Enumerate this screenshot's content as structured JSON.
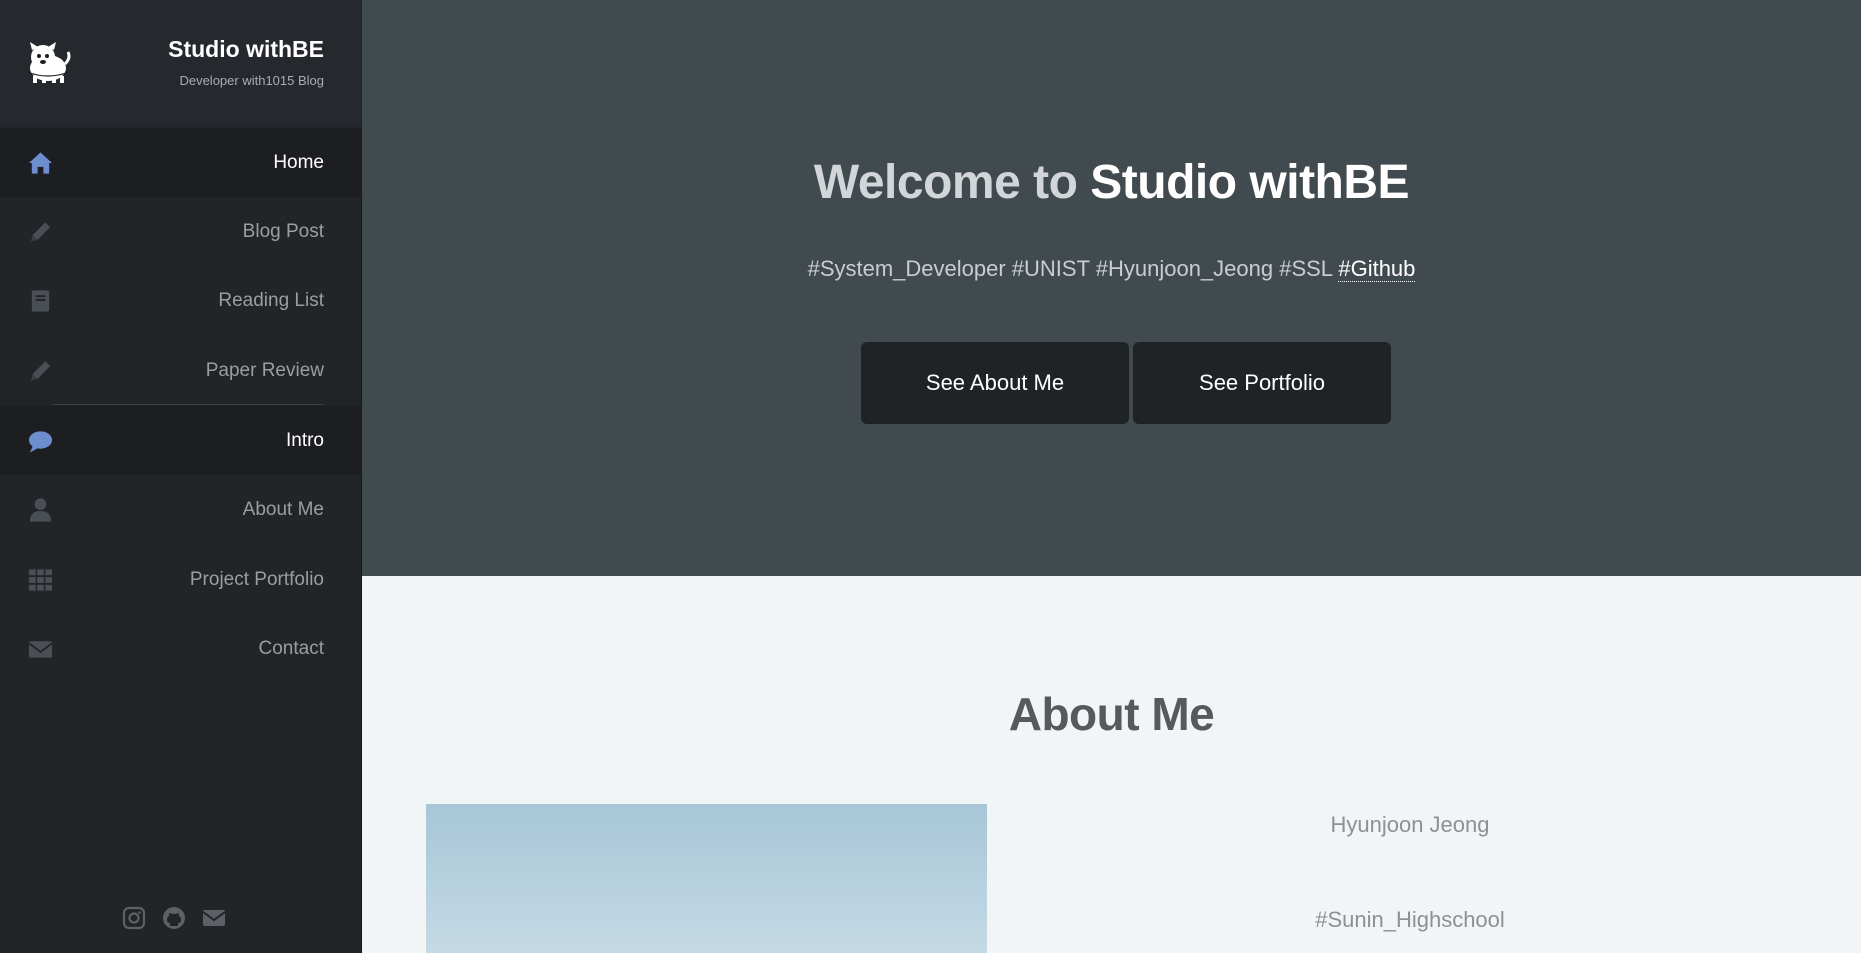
{
  "brand": {
    "title": "Studio withBE",
    "subtitle": "Developer with1015 Blog",
    "logo_icon": "dog-logo-icon"
  },
  "nav": {
    "items": [
      {
        "label": "Home",
        "icon": "home-icon",
        "active": true
      },
      {
        "label": "Blog Post",
        "icon": "pencil-icon",
        "active": false
      },
      {
        "label": "Reading List",
        "icon": "book-icon",
        "active": false
      },
      {
        "label": "Paper Review",
        "icon": "pencil-icon",
        "active": false
      },
      {
        "label": "Intro",
        "icon": "comment-icon",
        "active": true
      },
      {
        "label": "About Me",
        "icon": "user-icon",
        "active": false
      },
      {
        "label": "Project Portfolio",
        "icon": "grid-icon",
        "active": false
      },
      {
        "label": "Contact",
        "icon": "envelope-icon",
        "active": false
      }
    ]
  },
  "social": [
    "instagram-icon",
    "github-icon",
    "envelope-icon"
  ],
  "hero": {
    "title_prefix": "Welcome to",
    "title_accent": "Studio withBE",
    "tags": "#System_Developer #UNIST #Hyunjoon_Jeong #SSL",
    "github_link": "#Github",
    "btn_about": "See About Me",
    "btn_portfolio": "See Portfolio"
  },
  "about": {
    "title": "About Me",
    "name": "Hyunjoon Jeong",
    "school": "#Sunin_Highschool"
  },
  "colors": {
    "sidebar_bg": "#222528",
    "hero_bg": "#414a4f",
    "active_icon": "#6c8ecf",
    "inactive_icon": "#4a4f55",
    "button_bg": "#202325"
  }
}
